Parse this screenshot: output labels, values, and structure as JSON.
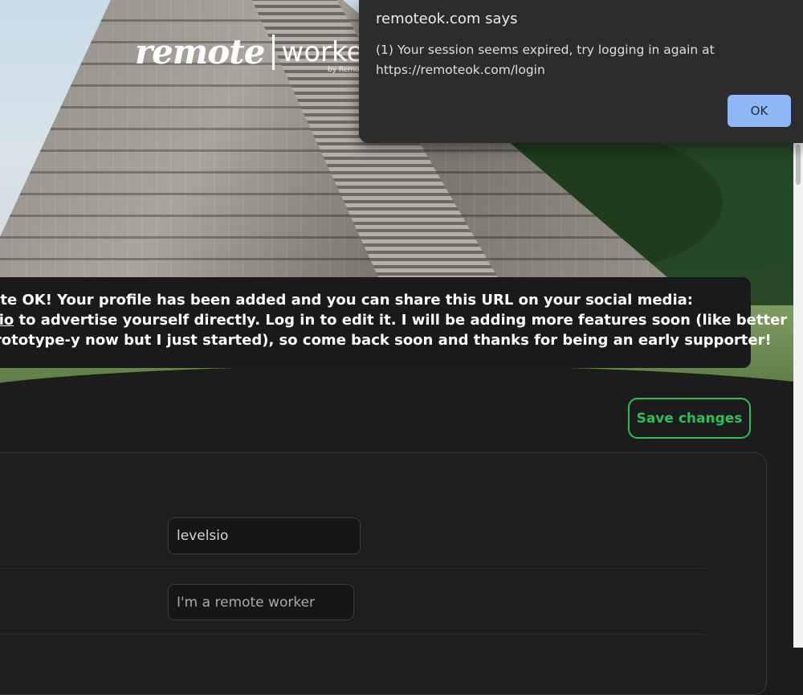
{
  "logo": {
    "brand_left": "remote",
    "brand_right": "worker",
    "byline": "by Remo"
  },
  "banner": {
    "line1": "ote OK! Your profile has been added and you can share this URL on your social media:",
    "line2_link": "sio",
    "line2_rest": " to advertise yourself directly. Log in to edit it. I will be adding more features soon (like better",
    "line3": " prototype-y now but I just started), so come back soon and thanks for being an early supporter!"
  },
  "toolbar": {
    "save_label": "Save changes"
  },
  "form": {
    "username_value": "levelsio",
    "tagline_value": "I'm a remote worker"
  },
  "dialog": {
    "title": "remoteok.com says",
    "message": "(1) Your session seems expired, try logging in again at https://remoteok.com/login",
    "ok_label": "OK"
  },
  "colors": {
    "accent_green": "#2ebd59",
    "dialog_button": "#8fb6f5",
    "background": "#1c1c1d"
  }
}
